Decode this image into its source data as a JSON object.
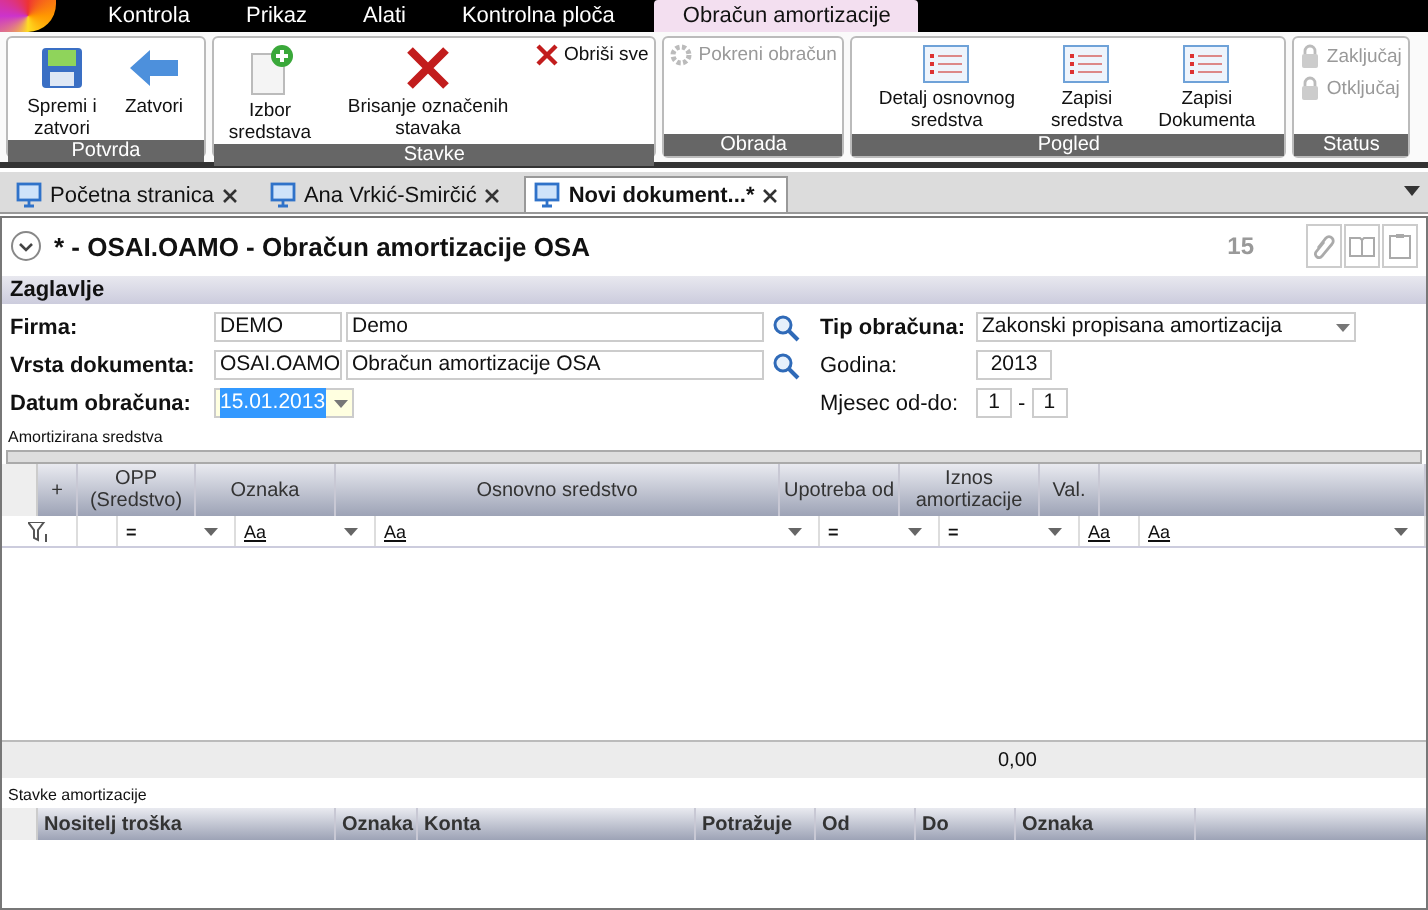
{
  "menu_tabs": [
    {
      "label": "Kontrola",
      "selected": false
    },
    {
      "label": "Prikaz",
      "selected": false
    },
    {
      "label": "Alati",
      "selected": false
    },
    {
      "label": "Kontrolna ploča",
      "selected": false
    },
    {
      "label": "Obračun amortizacije",
      "selected": true
    }
  ],
  "ribbon_groups": [
    {
      "label": "Potvrda",
      "buttons": [
        {
          "kind": "large",
          "label": "Spremi i zatvori",
          "disabled": false
        },
        {
          "kind": "large",
          "label": "Zatvori",
          "disabled": false
        }
      ]
    },
    {
      "label": "Stavke",
      "buttons": [
        {
          "kind": "large",
          "label": "Izbor sredstava",
          "disabled": false
        },
        {
          "kind": "large",
          "label": "Brisanje označenih stavaka",
          "disabled": false
        },
        {
          "kind": "small",
          "label": "Obriši sve",
          "disabled": false
        }
      ]
    },
    {
      "label": "Obrada",
      "buttons": [
        {
          "kind": "small",
          "label": "Pokreni obračun",
          "disabled": true
        }
      ]
    },
    {
      "label": "Pogled",
      "buttons": [
        {
          "kind": "large",
          "label": "Detalj osnovnog sredstva",
          "disabled": false
        },
        {
          "kind": "large",
          "label": "Zapisi sredstva",
          "disabled": false
        },
        {
          "kind": "large",
          "label": "Zapisi Dokumenta",
          "disabled": false
        }
      ]
    },
    {
      "label": "Status",
      "buttons": [
        {
          "kind": "small",
          "label": "Zaključaj",
          "disabled": true
        },
        {
          "kind": "small",
          "label": "Otključaj",
          "disabled": true
        }
      ]
    }
  ],
  "doc_tabs": [
    {
      "label": "Početna stranica",
      "selected": false
    },
    {
      "label": "Ana Vrkić-Smirčić",
      "selected": false
    },
    {
      "label": "Novi dokument...*",
      "selected": true
    }
  ],
  "document": {
    "title": "*  -  OSAI.OAMO  -  Obračun amortizacije OSA",
    "count": "15"
  },
  "section": "Zaglavlje",
  "form_left": [
    {
      "kind": "lookup",
      "label": "Firma:",
      "code": "DEMO",
      "value": "Demo"
    },
    {
      "kind": "lookup",
      "label": "Vrsta dokumenta:",
      "code": "OSAI.OAMO",
      "value": "Obračun amortizacije OSA"
    },
    {
      "kind": "date",
      "label": "Datum obračuna:",
      "value": "15.01.2013"
    }
  ],
  "form_right": [
    {
      "kind": "select",
      "label": "Tip obračuna:",
      "value": "Zakonski propisana amortizacija"
    },
    {
      "kind": "number",
      "label": "Godina:",
      "value": "2013"
    },
    {
      "kind": "range",
      "label": "Mjesec od-do:",
      "from": "1",
      "separator": "-",
      "to": "1"
    }
  ],
  "assets_grid": {
    "title": "Amortizirana sredstva",
    "columns": [
      {
        "label": "+"
      },
      {
        "label": "OPP (Sredstvo)",
        "filter": "="
      },
      {
        "label": "Oznaka",
        "filter": "Aa"
      },
      {
        "label": "Osnovno sredstvo",
        "filter": "Aa"
      },
      {
        "label": "Upotreba od",
        "filter": "="
      },
      {
        "label": "Iznos amortizacije",
        "filter": "="
      },
      {
        "label": "Val.",
        "filter": "Aa"
      },
      {
        "filter": "Aa"
      }
    ],
    "total": "0,00"
  },
  "items_grid": {
    "title": "Stavke amortizacije",
    "columns": [
      "Nositelj troška",
      "Oznaka",
      "Konta",
      "Potražuje",
      "Od",
      "Do",
      "Oznaka"
    ]
  }
}
